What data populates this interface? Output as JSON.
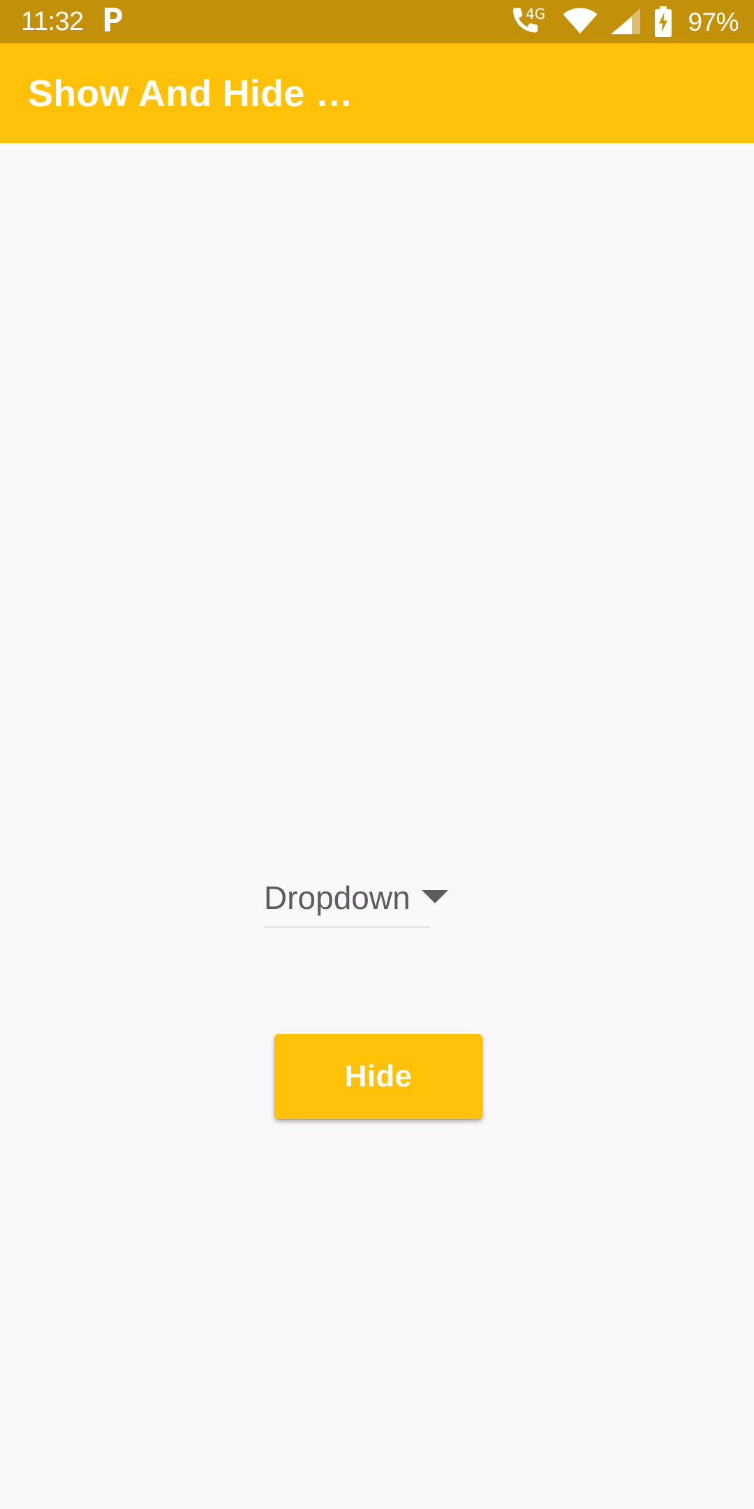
{
  "status_bar": {
    "time": "11:32",
    "notification_icon": "paytm-p-icon",
    "notification_glyph": "₱",
    "network_type": "4G",
    "icons": [
      "volte-4g-icon",
      "wifi-icon",
      "cellular-signal-icon",
      "battery-charging-icon"
    ],
    "battery_percent": "97%",
    "background_color": "#C29009",
    "foreground_color": "#FFFFFF"
  },
  "app_bar": {
    "title": "Show And Hide …",
    "background_color": "#FFC107",
    "title_color": "#FFFFFF"
  },
  "content": {
    "background_color": "#FAF8FB",
    "spinner": {
      "label": "Dropdown",
      "arrow_icon": "chevron-down-icon",
      "text_color": "#5C5C60",
      "underline_color": "#E2E0E4"
    },
    "button": {
      "label": "Hide",
      "background_color": "#FFC107",
      "text_color": "#FFFFFF"
    }
  }
}
